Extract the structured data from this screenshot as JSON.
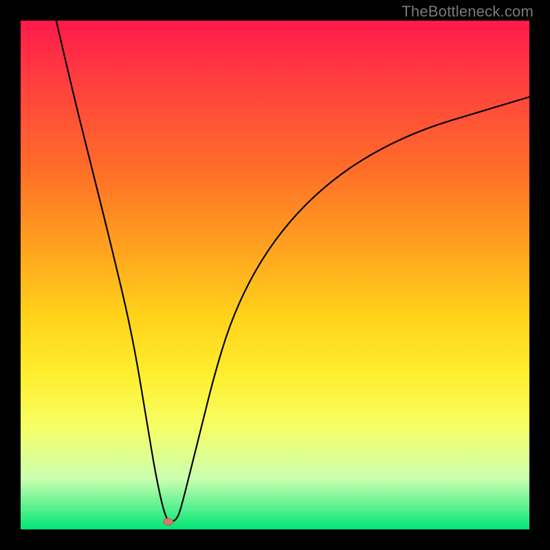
{
  "attribution": "TheBottleneck.com",
  "chart_data": {
    "type": "line",
    "title": "",
    "xlabel": "",
    "ylabel": "",
    "xlim": [
      0,
      100
    ],
    "ylim": [
      0,
      100
    ],
    "background_gradient": {
      "top": "#ff1a4b",
      "mid": "#ffd21a",
      "bottom": "#00e676"
    },
    "marker": {
      "x": 29,
      "y": 1.5,
      "color": "#d9776b"
    },
    "series": [
      {
        "name": "curve",
        "x": [
          7,
          10,
          14,
          18,
          22,
          25,
          26.5,
          28,
          29,
          30,
          31,
          32,
          34,
          36,
          38,
          41,
          45,
          50,
          56,
          63,
          71,
          80,
          90,
          100
        ],
        "y": [
          100,
          87,
          71,
          55,
          38,
          20,
          11,
          4,
          1.5,
          1.5,
          2.5,
          6,
          14,
          22,
          30,
          40,
          49,
          57,
          64,
          70,
          75,
          79,
          82,
          85
        ]
      }
    ]
  }
}
